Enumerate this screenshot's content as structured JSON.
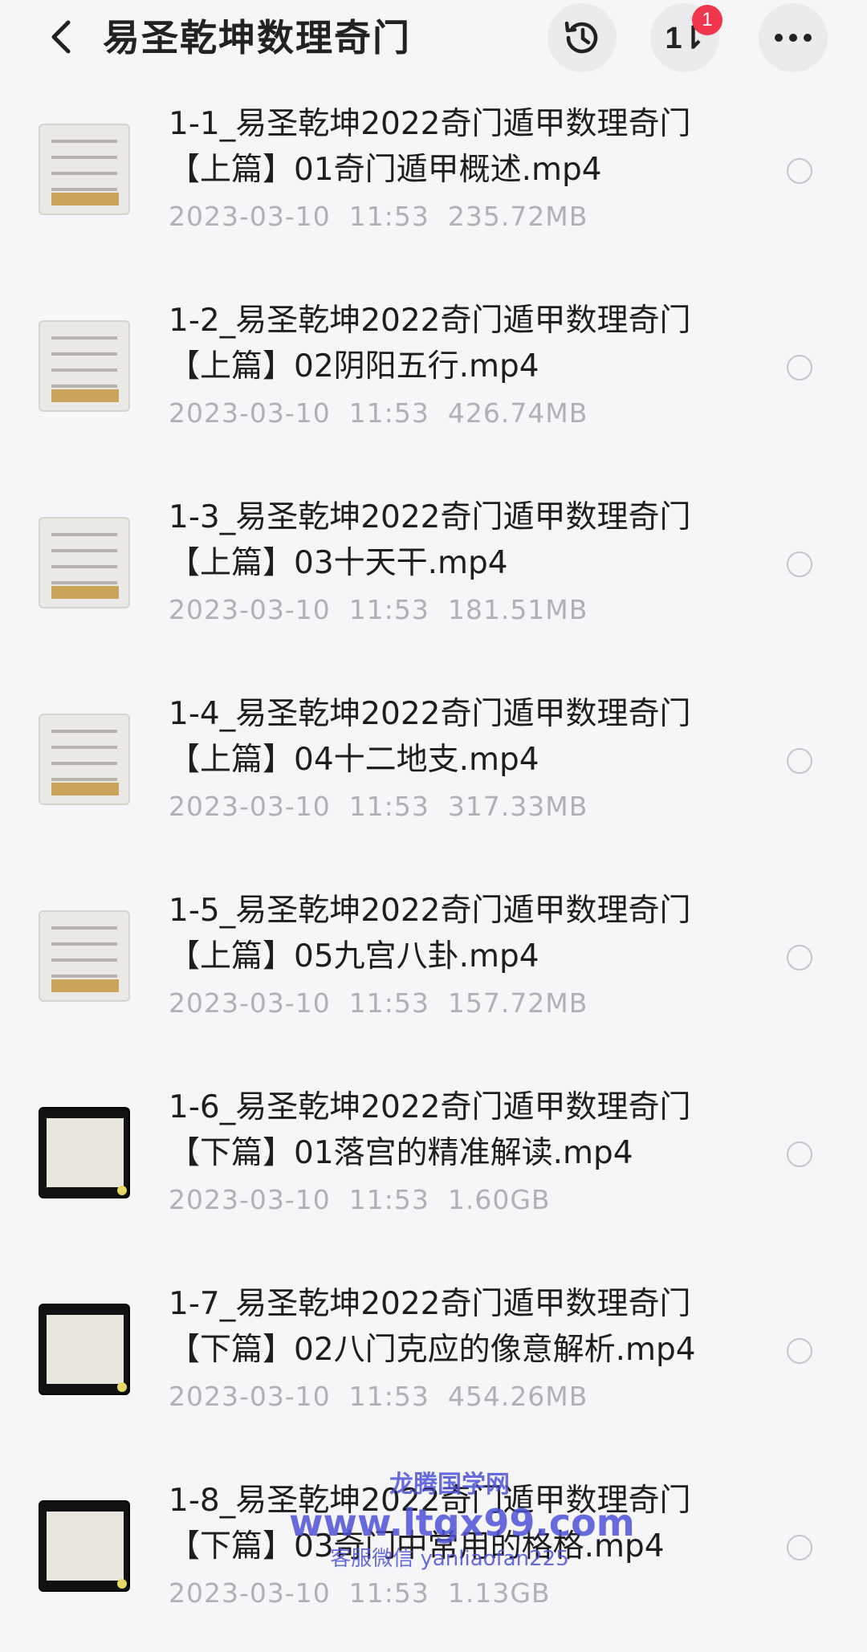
{
  "header": {
    "title": "易圣乾坤数理奇门",
    "back_icon": "chevron-left-icon",
    "history_icon": "history-clock-icon",
    "sort_label": "1⇂",
    "sort_badge": "1",
    "more_icon": "more-horizontal-icon",
    "badge_color": "#f0364c"
  },
  "files": [
    {
      "line1": "1-1_易圣乾坤2022奇门遁甲数理奇门",
      "line2": "【上篇】01奇门遁甲概述.mp4",
      "meta": "2023-03-10  11:53  235.72MB",
      "thumb": "light"
    },
    {
      "line1": "1-2_易圣乾坤2022奇门遁甲数理奇门",
      "line2": "【上篇】02阴阳五行.mp4",
      "meta": "2023-03-10  11:53  426.74MB",
      "thumb": "light"
    },
    {
      "line1": "1-3_易圣乾坤2022奇门遁甲数理奇门",
      "line2": "【上篇】03十天干.mp4",
      "meta": "2023-03-10  11:53  181.51MB",
      "thumb": "light"
    },
    {
      "line1": "1-4_易圣乾坤2022奇门遁甲数理奇门",
      "line2": "【上篇】04十二地支.mp4",
      "meta": "2023-03-10  11:53  317.33MB",
      "thumb": "light"
    },
    {
      "line1": "1-5_易圣乾坤2022奇门遁甲数理奇门",
      "line2": "【上篇】05九宫八卦.mp4",
      "meta": "2023-03-10  11:53  157.72MB",
      "thumb": "light"
    },
    {
      "line1": "1-6_易圣乾坤2022奇门遁甲数理奇门",
      "line2": "【下篇】01落宫的精准解读.mp4",
      "meta": "2023-03-10  11:53  1.60GB",
      "thumb": "dark"
    },
    {
      "line1": "1-7_易圣乾坤2022奇门遁甲数理奇门",
      "line2": "【下篇】02八门克应的像意解析.mp4",
      "meta": "2023-03-10  11:53  454.26MB",
      "thumb": "dark"
    },
    {
      "line1": "1-8_易圣乾坤2022奇门遁甲数理奇门",
      "line2": "【下篇】03奇门中常用的格格.mp4",
      "meta": "2023-03-10  11:53  1.13GB",
      "thumb": "dark"
    }
  ],
  "watermark": {
    "line1": "龙腾国学网",
    "line2": "www.ltgx99.com",
    "line3": "客服微信 yanliaofan225"
  }
}
